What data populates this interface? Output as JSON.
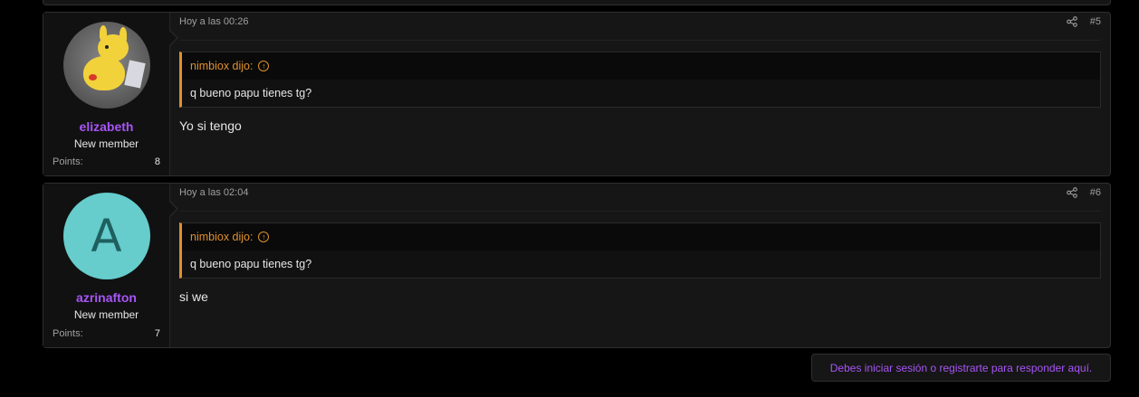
{
  "posts": [
    {
      "username": "elizabeth",
      "user_title": "New member",
      "points_label": "Points:",
      "points": "8",
      "avatar": "pikachu-photo",
      "timestamp": "Hoy a las 00:26",
      "post_number": "#5",
      "quote_author": "nimbiox dijo:",
      "quote_text": "q bueno papu tienes tg?",
      "message": "Yo si tengo"
    },
    {
      "username": "azrinafton",
      "user_title": "New member",
      "points_label": "Points:",
      "points": "7",
      "avatar_letter": "A",
      "timestamp": "Hoy a las 02:04",
      "post_number": "#6",
      "quote_author": "nimbiox dijo:",
      "quote_text": "q bueno papu tienes tg?",
      "message": "si we"
    }
  ],
  "reply_notice": "Debes iniciar sesión o registrarte para responder aquí.",
  "colors": {
    "username": "#a855f7",
    "quote_accent": "#e0902d",
    "avatar_letter_bg": "#66cccc"
  }
}
